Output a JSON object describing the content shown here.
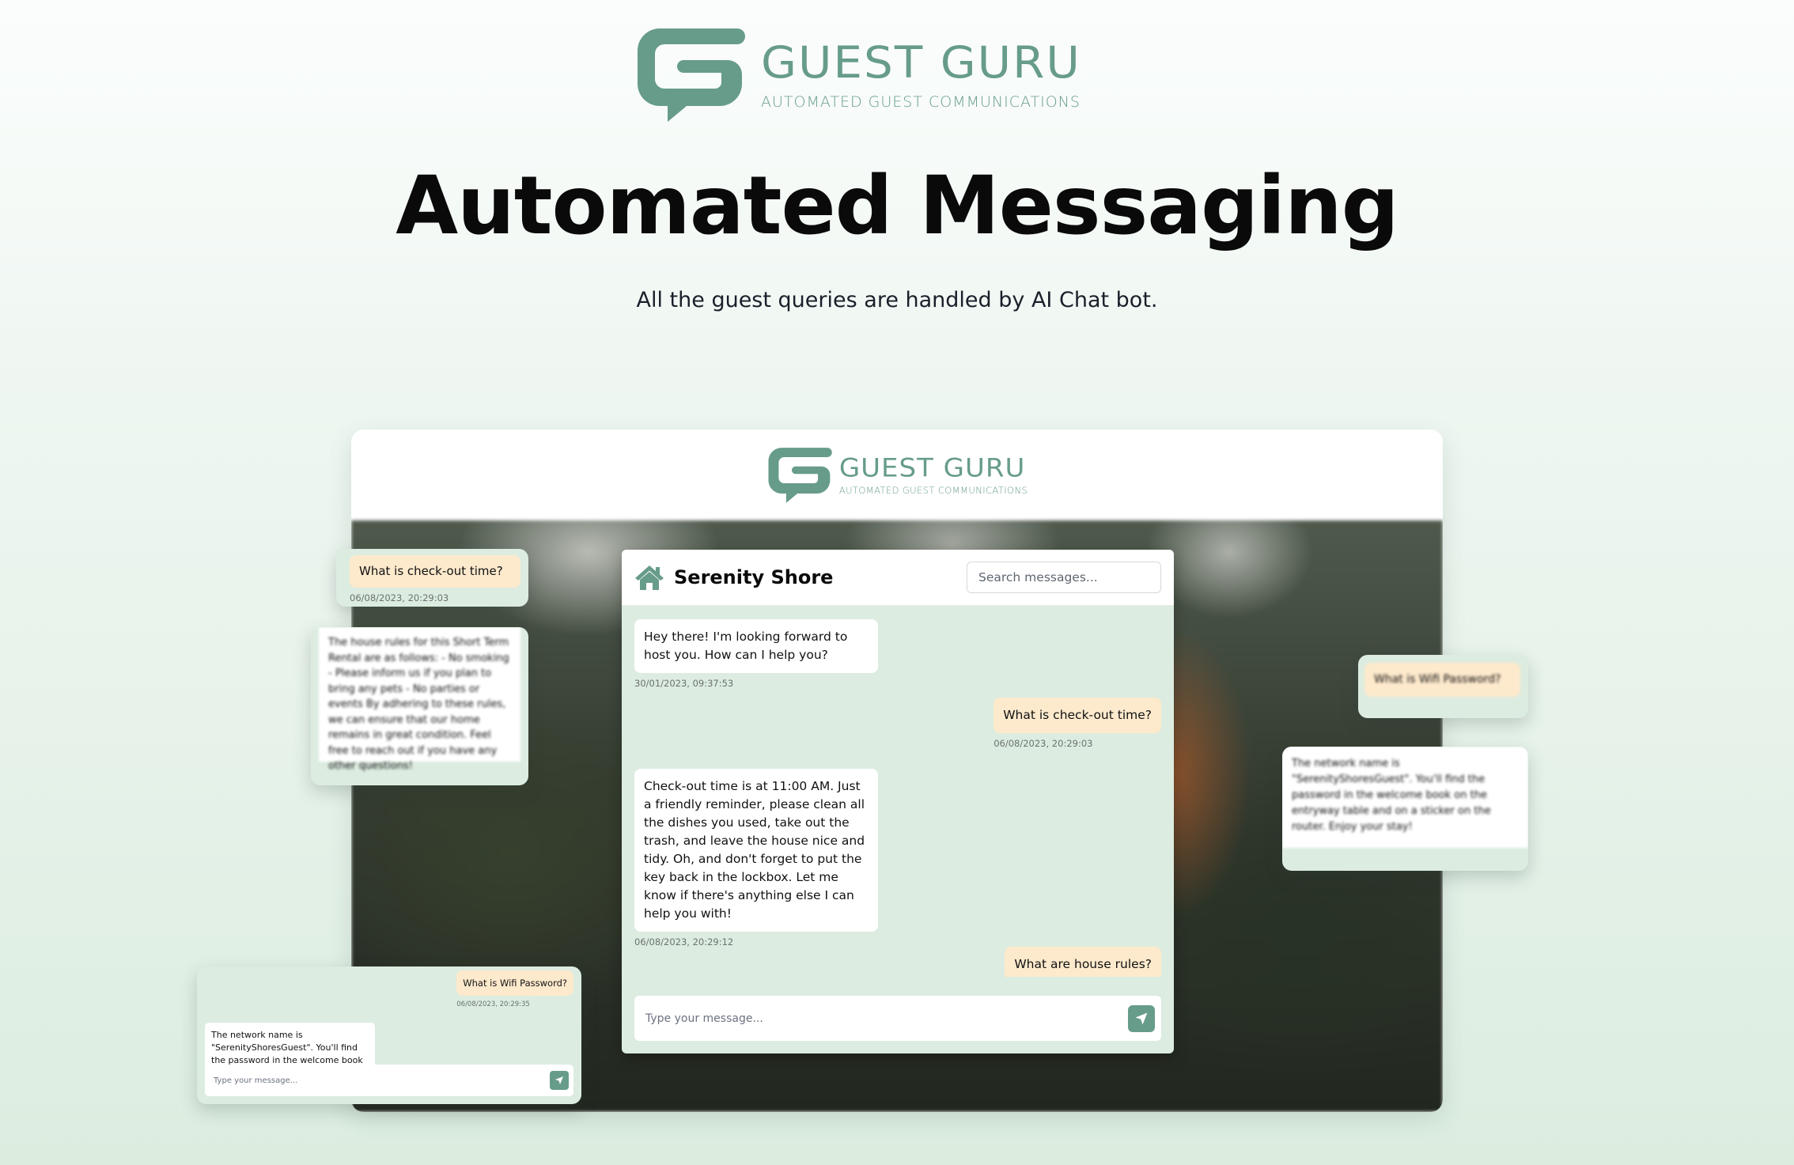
{
  "brand": {
    "name": "GUEST GURU",
    "tagline": "AUTOMATED GUEST COMMUNICATIONS",
    "logo_icon": "speech-bubble-g-logo",
    "color": "#679c8a"
  },
  "hero": {
    "title": "Automated Messaging",
    "subtitle": "All the guest queries are handled by AI Chat bot."
  },
  "app": {
    "header_brand": {
      "name": "GUEST GURU",
      "tagline": "AUTOMATED GUEST COMMUNICATIONS"
    },
    "chat": {
      "property_icon": "home-icon",
      "property_name": "Serenity Shore",
      "search": {
        "placeholder": "Search messages...",
        "value": ""
      },
      "messages": [
        {
          "sender": "bot",
          "text": "Hey there! I'm looking forward to host you. How can I help you?",
          "timestamp": "30/01/2023, 09:37:53"
        },
        {
          "sender": "guest",
          "text": "What is check-out time?",
          "timestamp": "06/08/2023, 20:29:03"
        },
        {
          "sender": "bot",
          "text": "Check-out time is at 11:00 AM. Just a friendly reminder, please clean all the dishes you used, take out the trash, and leave the house nice and tidy. Oh, and don't forget to put the key back in the lockbox. Let me know if there's anything else I can help you with!",
          "timestamp": "06/08/2023, 20:29:12"
        },
        {
          "sender": "guest",
          "text": "What are house rules?",
          "timestamp": ""
        }
      ],
      "composer": {
        "placeholder": "Type your message...",
        "value": "",
        "send_icon": "send-icon"
      }
    }
  },
  "floating_cards": {
    "left_question": {
      "text": "What is check-out time?",
      "timestamp": "06/08/2023, 20:29:03"
    },
    "left_answer": {
      "text": "The house rules for this Short Term Rental are as follows: - No smoking - Please inform us if you plan to bring any pets - No parties or events By adhering to these rules, we can ensure that our home remains in great condition. Feel free to reach out if you have any other questions!"
    },
    "right_question": {
      "text": "What is Wifi Password?"
    },
    "right_answer": {
      "text": "The network name is \"SerenityShoresGuest\". You'll find the password in the welcome book on the entryway table and on a sticker on the router. Enjoy your stay!"
    },
    "mini_chat": {
      "question": "What is Wifi Password?",
      "question_timestamp": "06/08/2023, 20:29:35",
      "answer": "The network name is \"SerenityShoresGuest\". You'll find the password in the welcome book on the entryway table and on a sticker",
      "composer_placeholder": "Type your message..."
    }
  },
  "colors": {
    "brand_green": "#679c8a",
    "chat_background": "#dcece0",
    "guest_bubble": "#fde9cc",
    "bot_bubble": "#ffffff",
    "timestamp": "#6b7170"
  }
}
